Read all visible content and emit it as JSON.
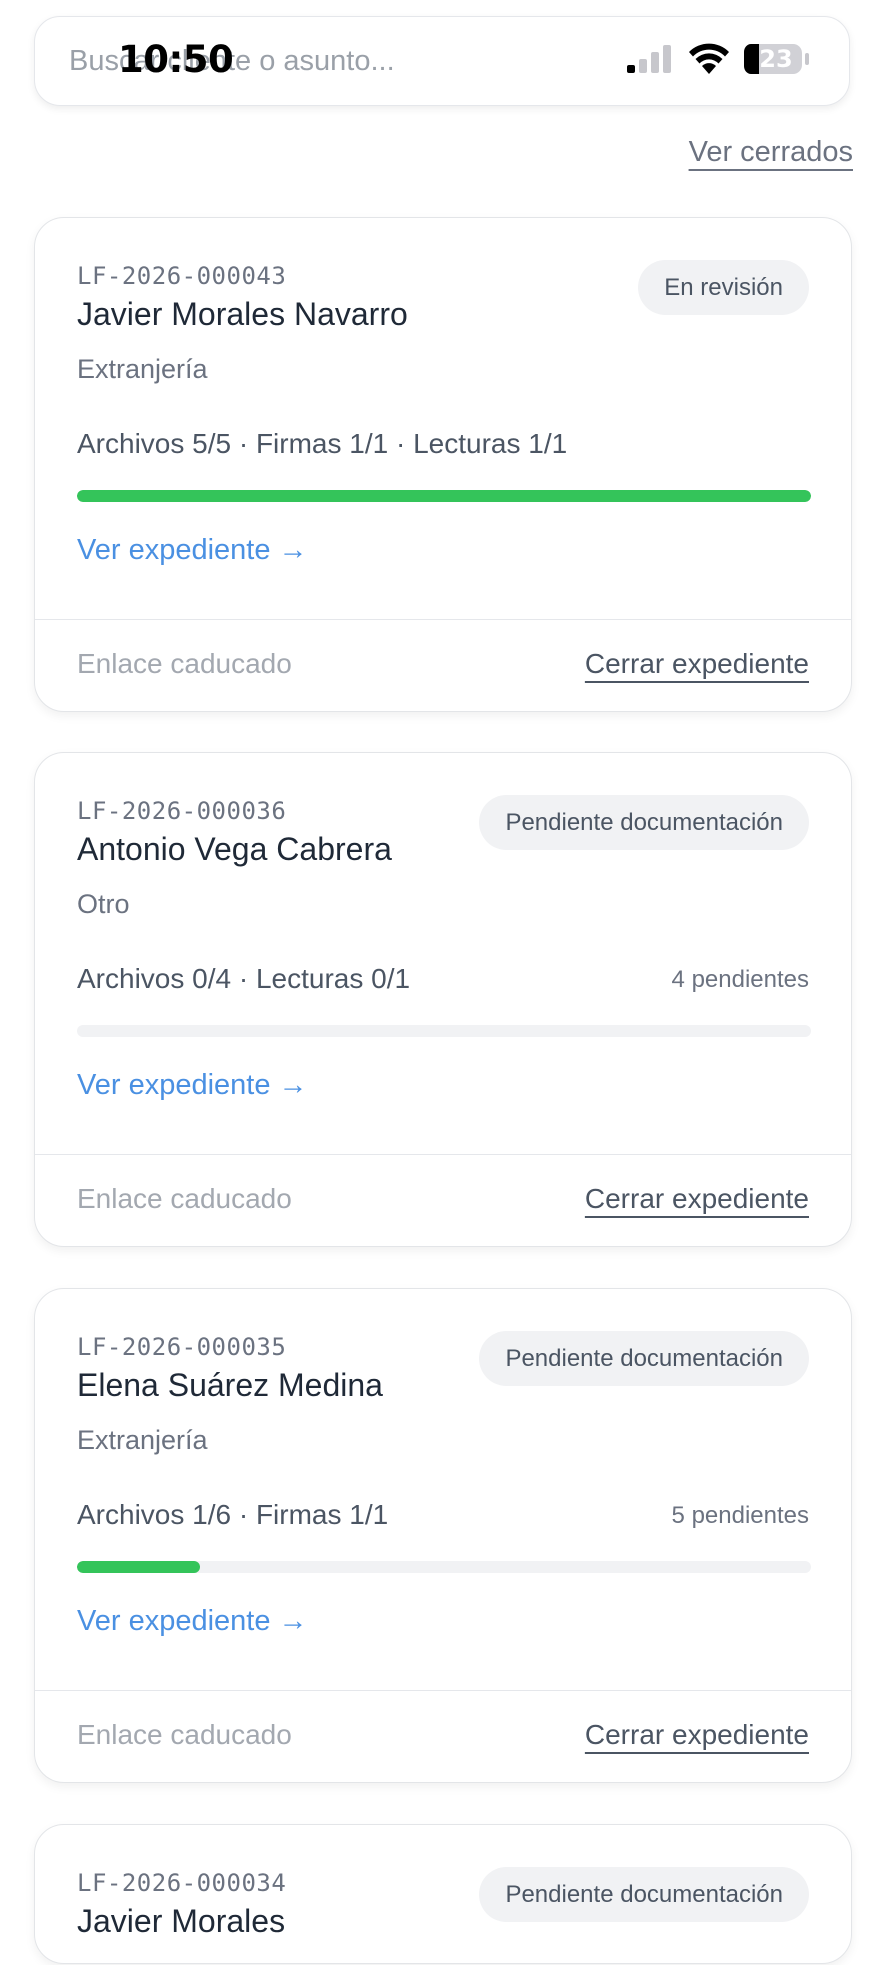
{
  "status_bar": {
    "time": "10:50",
    "battery_level": "23"
  },
  "search": {
    "placeholder": "Buscar cliente o asunto..."
  },
  "header": {
    "view_closed_label": "Ver cerrados"
  },
  "cases": [
    {
      "code": "LF-2026-000043",
      "client": "Javier Morales Navarro",
      "category": "Extranjería",
      "status": "En revisión",
      "summary": "Archivos 5/5 · Firmas 1/1 · Lecturas 1/1",
      "pending": "",
      "progress": 1.0,
      "view_label": "Ver expediente →",
      "link_status": "Enlace caducado",
      "close_label": "Cerrar expediente"
    },
    {
      "code": "LF-2026-000036",
      "client": "Antonio Vega Cabrera",
      "category": "Otro",
      "status": "Pendiente documentación",
      "summary": "Archivos 0/4 · Lecturas 0/1",
      "pending": "4 pendientes",
      "progress": 0.0,
      "view_label": "Ver expediente →",
      "link_status": "Enlace caducado",
      "close_label": "Cerrar expediente"
    },
    {
      "code": "LF-2026-000035",
      "client": "Elena Suárez Medina",
      "category": "Extranjería",
      "status": "Pendiente documentación",
      "summary": "Archivos 1/6 · Firmas 1/1",
      "pending": "5 pendientes",
      "progress": 0.167,
      "view_label": "Ver expediente →",
      "link_status": "Enlace caducado",
      "close_label": "Cerrar expediente"
    },
    {
      "code": "LF-2026-000034",
      "client": "Javier Morales",
      "status": "Pendiente documentación"
    }
  ],
  "colors": {
    "progress_fill": "#34c45a",
    "link": "#4a90e2",
    "badge_bg": "#f1f2f4"
  }
}
